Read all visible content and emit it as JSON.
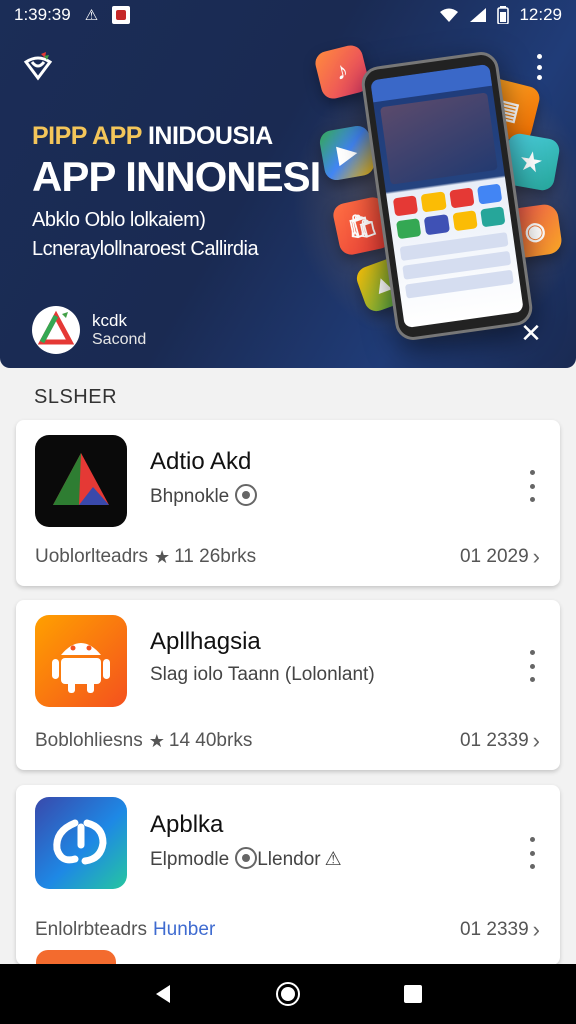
{
  "status_bar": {
    "left_time": "1:39:39",
    "right_time": "12:29",
    "icons": [
      "warning-icon",
      "app-notification-icon",
      "wifi-icon",
      "signal-icon",
      "battery-icon"
    ]
  },
  "banner": {
    "headline_small_a": "PIPP APP",
    "headline_small_b": "INIDOUSIA",
    "headline_big": "APP INNONESI",
    "sub_line_1": "Abklo Oblo lolkaiem)",
    "sub_line_2": "Lcneraylollnaroest Callirdia",
    "promo_name": "kcdk",
    "promo_sub": "Sacond",
    "close_label": "✕",
    "colors": {
      "background": "#1b2d57",
      "accent": "#f4c65a"
    }
  },
  "section": {
    "title": "SLSHER"
  },
  "apps": [
    {
      "name": "Adtio Akd",
      "developer": "Bhpnokle",
      "meta_label": "Uoblorlteadrs",
      "rating_text": "11 26brks",
      "link_text": "",
      "date": "01 2029"
    },
    {
      "name": "Apllhagsia",
      "developer": "Slag iolo Taann (Lolonlant)",
      "meta_label": "Boblohliesns",
      "rating_text": "14 40brks",
      "link_text": "",
      "date": "01 2339"
    },
    {
      "name": "Apblka",
      "developer": "Elpmodle",
      "developer_extra": "Llendor",
      "meta_label": "Enlolrbteadrs",
      "rating_text": "",
      "link_text": "Hunber",
      "date": "01 2339"
    }
  ],
  "nav": {
    "icons": [
      "back-icon",
      "home-icon",
      "recents-icon"
    ]
  }
}
